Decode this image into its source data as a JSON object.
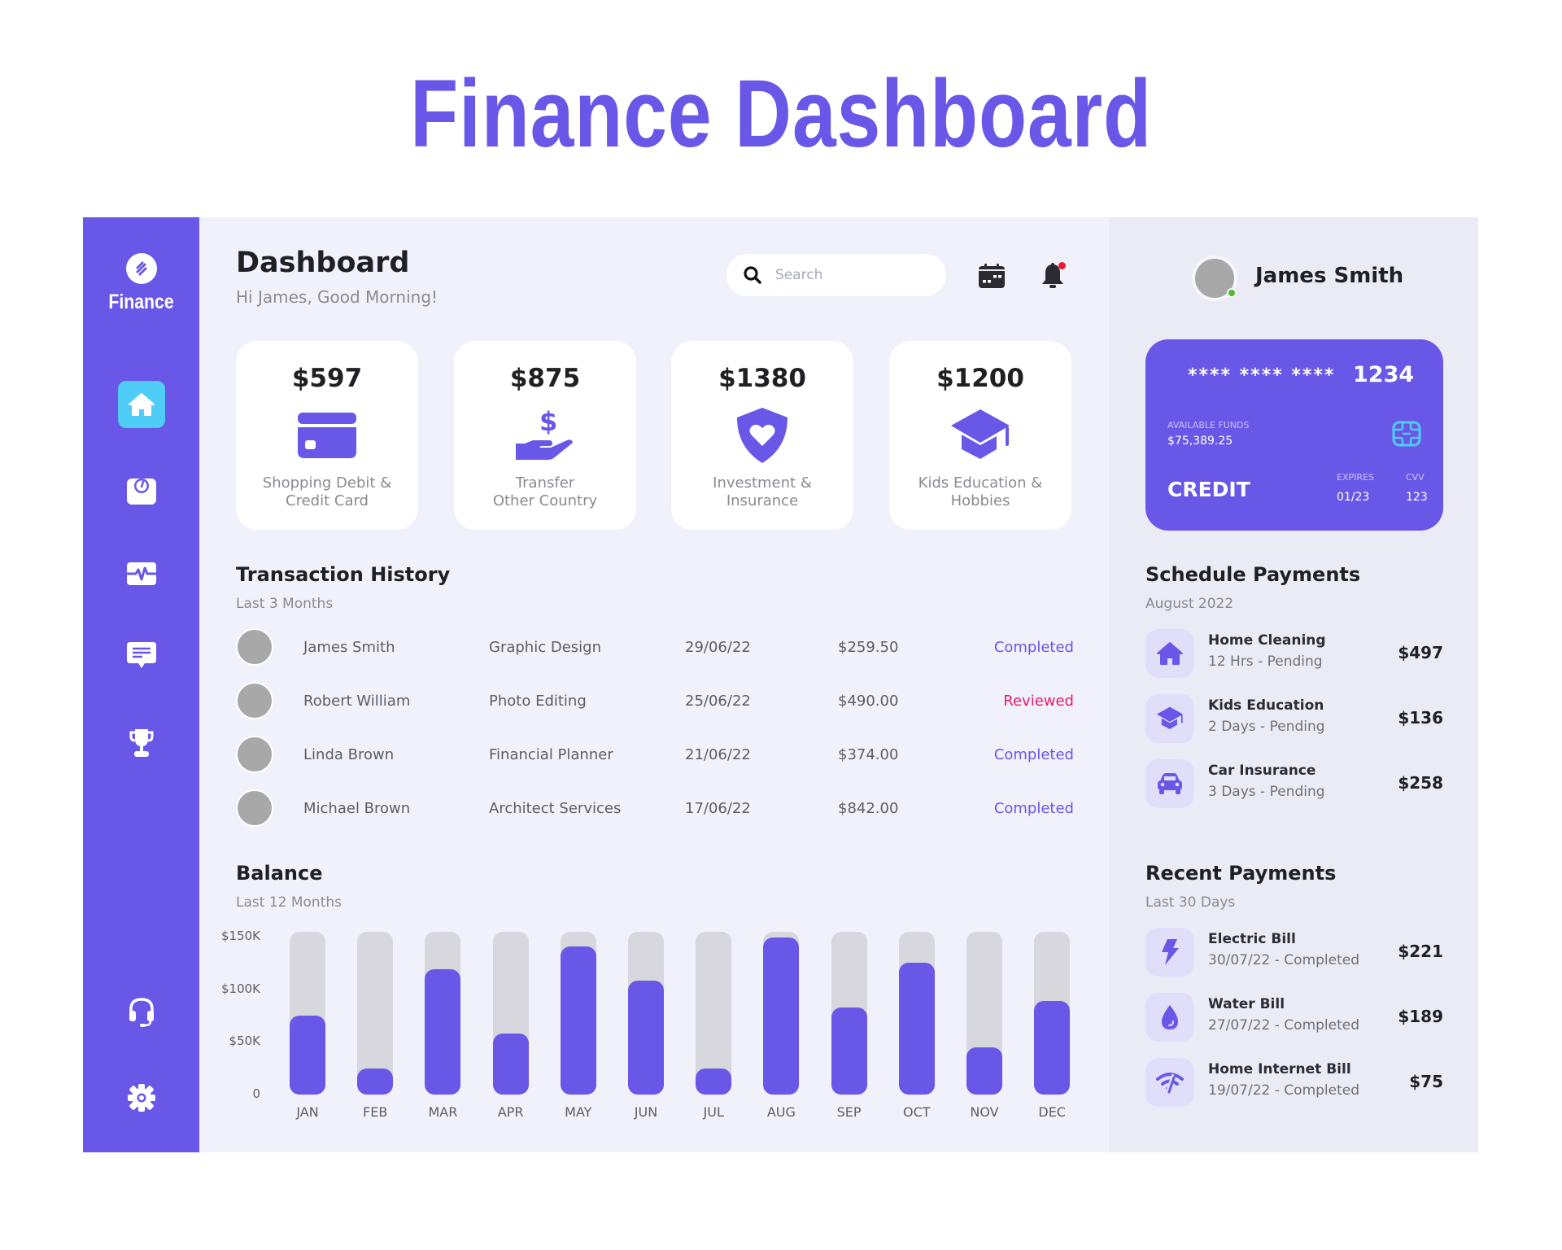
{
  "page_title": "Finance Dashboard",
  "colors": {
    "brand": "#6957e8",
    "active_nav": "#4fcdf7",
    "completed": "#6957e8",
    "reviewed": "#e8186f",
    "notification_dot": "#ee1b2e",
    "online": "#55b72c",
    "track": "#d7d7dd",
    "chip": "#4fcdf7"
  },
  "sidebar": {
    "brand_name": "Finance",
    "nav": [
      {
        "icon": "home-icon",
        "active": true
      },
      {
        "icon": "scale-gauge-icon",
        "active": false
      },
      {
        "icon": "activity-icon",
        "active": false
      },
      {
        "icon": "message-icon",
        "active": false
      },
      {
        "icon": "trophy-icon",
        "active": false
      }
    ],
    "bottom": [
      {
        "icon": "headset-icon"
      },
      {
        "icon": "settings-gear-icon"
      }
    ]
  },
  "header": {
    "title": "Dashboard",
    "greeting": "Hi James, Good Morning!",
    "search": {
      "placeholder": "Search",
      "value": ""
    }
  },
  "stats": [
    {
      "amount": "$597",
      "label_line1": "Shopping Debit &",
      "label_line2": "Credit Card",
      "icon": "credit-card-icon"
    },
    {
      "amount": "$875",
      "label_line1": "Transfer",
      "label_line2": "Other Country",
      "icon": "money-hand-icon"
    },
    {
      "amount": "$1380",
      "label_line1": "Investment &",
      "label_line2": "Insurance",
      "icon": "shield-heart-icon"
    },
    {
      "amount": "$1200",
      "label_line1": "Kids Education &",
      "label_line2": "Hobbies",
      "icon": "graduation-cap-icon"
    }
  ],
  "transactions": {
    "title": "Transaction History",
    "subtitle": "Last 3 Months",
    "rows": [
      {
        "name": "James Smith",
        "service": "Graphic Design",
        "date": "29/06/22",
        "amount": "$259.50",
        "status": "Completed"
      },
      {
        "name": "Robert William",
        "service": "Photo Editing",
        "date": "25/06/22",
        "amount": "$490.00",
        "status": "Reviewed"
      },
      {
        "name": "Linda Brown",
        "service": "Financial Planner",
        "date": "21/06/22",
        "amount": "$374.00",
        "status": "Completed"
      },
      {
        "name": "Michael Brown",
        "service": "Architect Services",
        "date": "17/06/22",
        "amount": "$842.00",
        "status": "Completed"
      }
    ]
  },
  "balance": {
    "title": "Balance",
    "subtitle": "Last 12 Months"
  },
  "chart_data": {
    "type": "bar",
    "title": "Balance",
    "subtitle": "Last 12 Months",
    "xlabel": "",
    "ylabel": "",
    "categories": [
      "JAN",
      "FEB",
      "MAR",
      "APR",
      "MAY",
      "JUN",
      "JUL",
      "AUG",
      "SEP",
      "OCT",
      "NOV",
      "DEC"
    ],
    "values": [
      75000,
      25000,
      119000,
      58000,
      141000,
      108000,
      25000,
      149000,
      83000,
      125000,
      45000,
      89000
    ],
    "track_max": 155000,
    "ylim": [
      0,
      150000
    ],
    "yticks": [
      0,
      50000,
      100000,
      150000
    ],
    "ytick_labels": [
      "0",
      "$50K",
      "$100K",
      "$150K"
    ],
    "grid": false,
    "legend": "none"
  },
  "profile": {
    "name": "James Smith",
    "online": true
  },
  "card": {
    "masked": "**** **** ****",
    "last4": "1234",
    "funds_label": "AVAILABLE FUNDS",
    "funds_value": "$75,389.25",
    "type": "CREDIT",
    "expires_label": "EXPIRES",
    "expires_value": "01/23",
    "cvv_label": "CVV",
    "cvv_value": "123"
  },
  "schedule": {
    "title": "Schedule Payments",
    "subtitle": "August 2022",
    "items": [
      {
        "title": "Home Cleaning",
        "sub": "12 Hrs - Pending",
        "amount": "$497",
        "icon": "home-icon"
      },
      {
        "title": "Kids Education",
        "sub": "2 Days - Pending",
        "amount": "$136",
        "icon": "graduation-cap-icon"
      },
      {
        "title": "Car Insurance",
        "sub": "3 Days - Pending",
        "amount": "$258",
        "icon": "car-icon"
      }
    ]
  },
  "recent": {
    "title": "Recent Payments",
    "subtitle": "Last 30 Days",
    "items": [
      {
        "title": "Electric Bill",
        "sub": "30/07/22 - Completed",
        "amount": "$221",
        "icon": "lightning-icon"
      },
      {
        "title": "Water Bill",
        "sub": "27/07/22 - Completed",
        "amount": "$189",
        "icon": "water-drop-icon"
      },
      {
        "title": "Home Internet Bill",
        "sub": "19/07/22 - Completed",
        "amount": "$75",
        "icon": "wifi-off-icon"
      }
    ]
  }
}
